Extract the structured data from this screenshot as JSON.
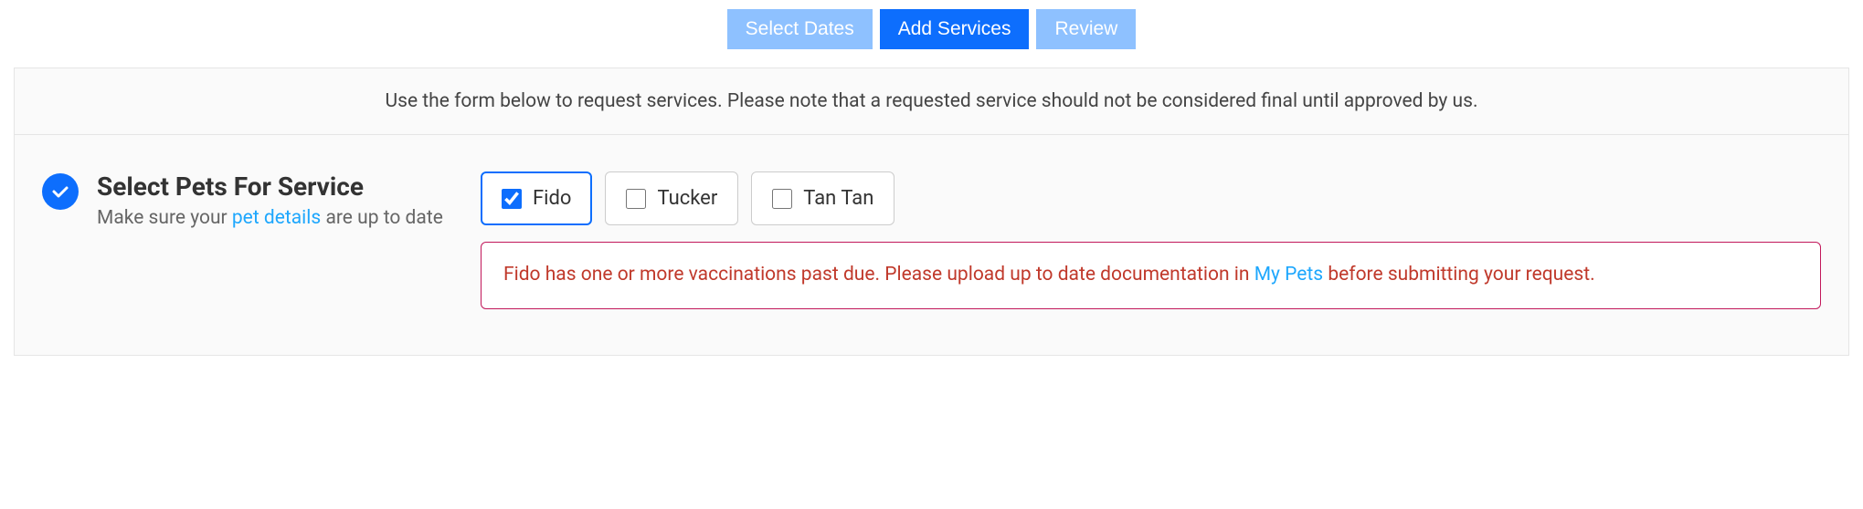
{
  "wizard": {
    "steps": [
      {
        "label": "Select Dates",
        "active": false
      },
      {
        "label": "Add Services",
        "active": true
      },
      {
        "label": "Review",
        "active": false
      }
    ]
  },
  "panel": {
    "intro": "Use the form below to request services. Please note that a requested service should not be considered final until approved by us."
  },
  "section": {
    "title": "Select Pets For Service",
    "sub_before": "Make sure your ",
    "sub_link": "pet details",
    "sub_after": " are up to date",
    "pets": [
      {
        "name": "Fido",
        "checked": true
      },
      {
        "name": "Tucker",
        "checked": false
      },
      {
        "name": "Tan Tan",
        "checked": false
      }
    ],
    "alert": {
      "text_before": "Fido has one or more vaccinations past due. Please upload up to date documentation in ",
      "link": "My Pets",
      "text_after": " before submitting your request."
    }
  }
}
